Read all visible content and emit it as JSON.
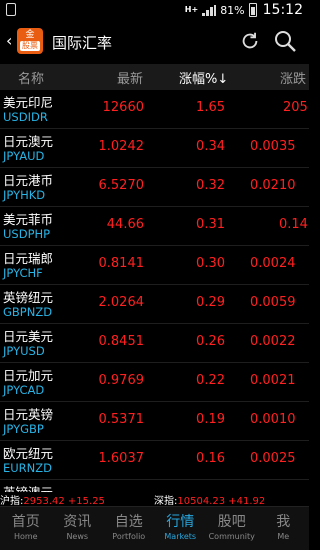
{
  "status_bar": {
    "network": "H+",
    "battery": "81%",
    "time": "15:12"
  },
  "app_bar": {
    "logo_top": "金",
    "logo_bottom": "股票",
    "title": "国际汇率"
  },
  "table_header": {
    "name": "名称",
    "latest": "最新",
    "pct": "涨幅%↓",
    "change": "涨跌"
  },
  "rows": [
    {
      "name": "美元印尼",
      "code": "USDIDR",
      "latest": "12660",
      "pct": "1.65",
      "change": "205"
    },
    {
      "name": "日元澳元",
      "code": "JPYAUD",
      "latest": "1.0242",
      "pct": "0.34",
      "change": "0.0035"
    },
    {
      "name": "日元港币",
      "code": "JPYHKD",
      "latest": "6.5270",
      "pct": "0.32",
      "change": "0.0210"
    },
    {
      "name": "美元菲币",
      "code": "USDPHP",
      "latest": "44.66",
      "pct": "0.31",
      "change": "0.14"
    },
    {
      "name": "日元瑞郎",
      "code": "JPYCHF",
      "latest": "0.8141",
      "pct": "0.30",
      "change": "0.0024"
    },
    {
      "name": "英镑纽元",
      "code": "GBPNZD",
      "latest": "2.0264",
      "pct": "0.29",
      "change": "0.0059"
    },
    {
      "name": "日元美元",
      "code": "JPYUSD",
      "latest": "0.8451",
      "pct": "0.26",
      "change": "0.0022"
    },
    {
      "name": "日元加元",
      "code": "JPYCAD",
      "latest": "0.9769",
      "pct": "0.22",
      "change": "0.0021"
    },
    {
      "name": "日元英镑",
      "code": "JPYGBP",
      "latest": "0.5371",
      "pct": "0.19",
      "change": "0.0010"
    },
    {
      "name": "欧元纽元",
      "code": "EURNZD",
      "latest": "1.6037",
      "pct": "0.16",
      "change": "0.0025"
    },
    {
      "name": "英镑澳元",
      "code": "",
      "latest": "",
      "pct": "",
      "change": ""
    }
  ],
  "ticker": {
    "sh_label": "沪指:",
    "sh_value": "2953.42 +15.25",
    "sz_label": "深指:",
    "sz_value": "10504.23 +41.92"
  },
  "tabs": [
    {
      "cn": "首页",
      "en": "Home"
    },
    {
      "cn": "资讯",
      "en": "News"
    },
    {
      "cn": "自选",
      "en": "Portfolio"
    },
    {
      "cn": "行情",
      "en": "Markets"
    },
    {
      "cn": "股吧",
      "en": "Community"
    },
    {
      "cn": "我",
      "en": "Me"
    }
  ],
  "colors": {
    "rise": "#ff2020",
    "code": "#28b4e6",
    "active_tab": "#28a8e0",
    "logo": "#e85d12"
  }
}
